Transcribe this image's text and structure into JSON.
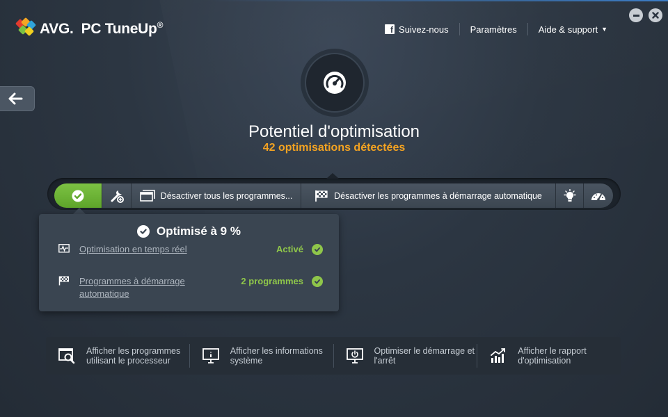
{
  "app": {
    "brand": "AVG.",
    "product": "PC TuneUp",
    "reg": "®"
  },
  "topnav": {
    "follow": "Suivez-nous",
    "settings": "Paramètres",
    "help": "Aide & support"
  },
  "hero": {
    "title": "Potentiel d'optimisation",
    "subtitle": "42 optimisations détectées"
  },
  "toolbar": {
    "disable_all": "Désactiver tous les programmes...",
    "disable_autostart": "Désactiver les programmes à démarrage automatique"
  },
  "popup": {
    "title": "Optimisé à 9 %",
    "rows": [
      {
        "label": "Optimisation en temps réel",
        "status": "Activé"
      },
      {
        "label": "Programmes à démarrage automatique",
        "status": "2 programmes"
      }
    ]
  },
  "bottom": {
    "items": [
      {
        "label": "Afficher les programmes utilisant le processeur"
      },
      {
        "label": "Afficher les informations système"
      },
      {
        "label": "Optimiser le démarrage et l'arrêt"
      },
      {
        "label": "Afficher le rapport d'optimisation"
      }
    ]
  },
  "colors": {
    "accent_green": "#7cc243",
    "accent_orange": "#f4a321",
    "background": "#2b3440"
  },
  "icons": [
    "facebook-icon",
    "minimize-icon",
    "close-icon",
    "back-arrow-icon",
    "speedometer-icon",
    "check-icon",
    "tools-icon",
    "window-icon",
    "checkered-flag-icon",
    "lightbulb-icon",
    "performance-gauge-icon",
    "pulse-monitor-icon",
    "cpu-search-icon",
    "system-info-icon",
    "startup-shutdown-icon",
    "report-chart-icon"
  ]
}
